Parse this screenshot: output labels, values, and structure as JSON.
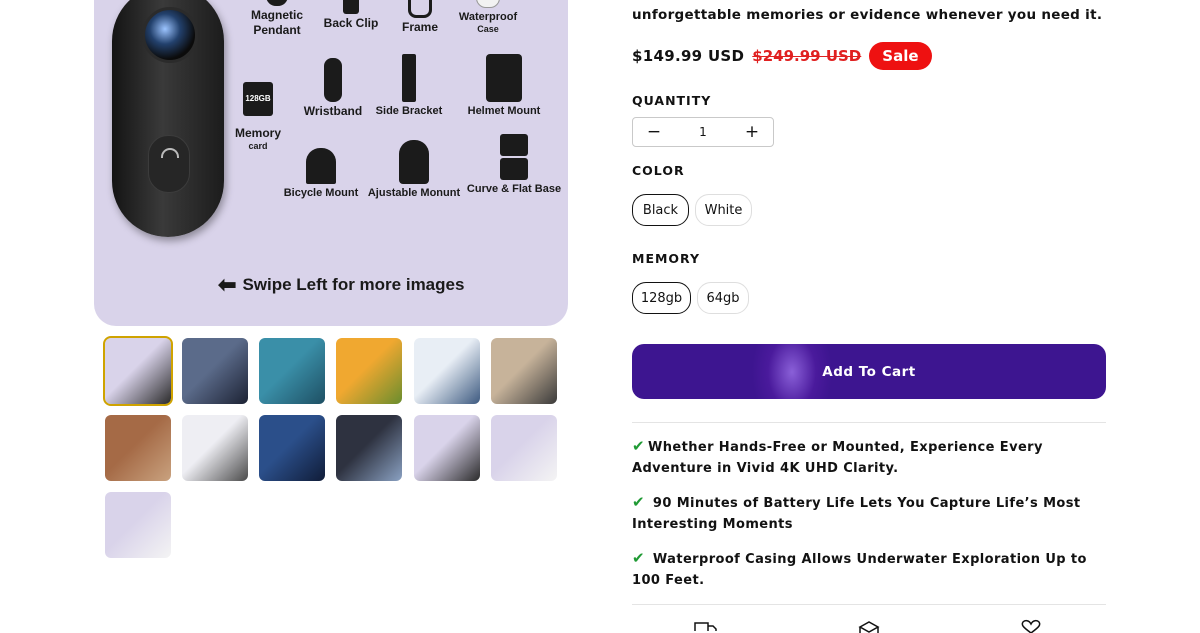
{
  "gallery": {
    "accessories": [
      {
        "label": "Magnetic",
        "sub_label": "Pendant",
        "icon": "magnetic-pendant-icon"
      },
      {
        "label": "Back Clip",
        "icon": "back-clip-icon"
      },
      {
        "label": "Frame",
        "icon": "frame-icon"
      },
      {
        "label": "Waterproof",
        "sub_label": "Case",
        "icon": "waterproof-case-icon"
      },
      {
        "label": "128GB",
        "icon": "memory-card-chip-icon"
      },
      {
        "label": "Memory",
        "sub_label": "card",
        "icon": "memory-card-icon"
      },
      {
        "label": "Wristband",
        "icon": "wristband-icon"
      },
      {
        "label": "Side Bracket",
        "icon": "side-bracket-icon"
      },
      {
        "label": "Helmet Mount",
        "icon": "helmet-mount-icon"
      },
      {
        "label": "Bicycle Mount",
        "icon": "bicycle-mount-icon"
      },
      {
        "label": "Ajustable Monunt",
        "icon": "adjustable-mount-icon"
      },
      {
        "label": "Curve & Flat Base",
        "icon": "curve-flat-base-icon"
      }
    ],
    "swipe_text": "Swipe Left for more images",
    "thumbnails": [
      {
        "colors": [
          "#d9d3ea",
          "#2b2b2b"
        ]
      },
      {
        "colors": [
          "#5b6b8a",
          "#1c2233"
        ]
      },
      {
        "colors": [
          "#3a8fa8",
          "#1e4f63"
        ]
      },
      {
        "colors": [
          "#f0a830",
          "#6a8d2e"
        ]
      },
      {
        "colors": [
          "#e8eef5",
          "#3d5a80"
        ]
      },
      {
        "colors": [
          "#c7b39a",
          "#3a3a3a"
        ]
      },
      {
        "colors": [
          "#a56a46",
          "#c9a27f"
        ]
      },
      {
        "colors": [
          "#eeeef3",
          "#4b4b4b"
        ]
      },
      {
        "colors": [
          "#2b4f8a",
          "#101c38"
        ]
      },
      {
        "colors": [
          "#2e3240",
          "#8aa1c2"
        ]
      },
      {
        "colors": [
          "#d9d3ea",
          "#2b2b2b"
        ]
      },
      {
        "colors": [
          "#d9d3ea",
          "#f4f4f4"
        ]
      },
      {
        "colors": [
          "#d9d3ea",
          "#f4f4f4"
        ]
      }
    ]
  },
  "product": {
    "tagline": "unforgettable memories or evidence whenever you need it.",
    "price": "$149.99 USD",
    "compare_price": "$249.99 USD",
    "sale_badge": "Sale",
    "quantity_label": "QUANTITY",
    "quantity_value": "1",
    "quantity_minus": "−",
    "quantity_plus": "+",
    "color_label": "COLOR",
    "color_options": [
      "Black",
      "White"
    ],
    "color_selected": "Black",
    "memory_label": "MEMORY",
    "memory_options": [
      "128gb",
      "64gb"
    ],
    "memory_selected": "128gb",
    "add_to_cart": "Add To Cart",
    "features": [
      "Whether Hands-Free or Mounted, Experience Every Adventure in Vivid 4K UHD Clarity.",
      "90 Minutes of Battery Life Lets You Capture Life’s Most Interesting Moments",
      "Waterproof Casing Allows Underwater Exploration Up to 100 Feet."
    ],
    "check_glyph": "✔",
    "accent_color": "#3d1590",
    "sale_color": "#ee1111",
    "check_color": "#1f9a34"
  },
  "bottom_icons": [
    "truck-icon",
    "box-icon",
    "heart-icon"
  ]
}
